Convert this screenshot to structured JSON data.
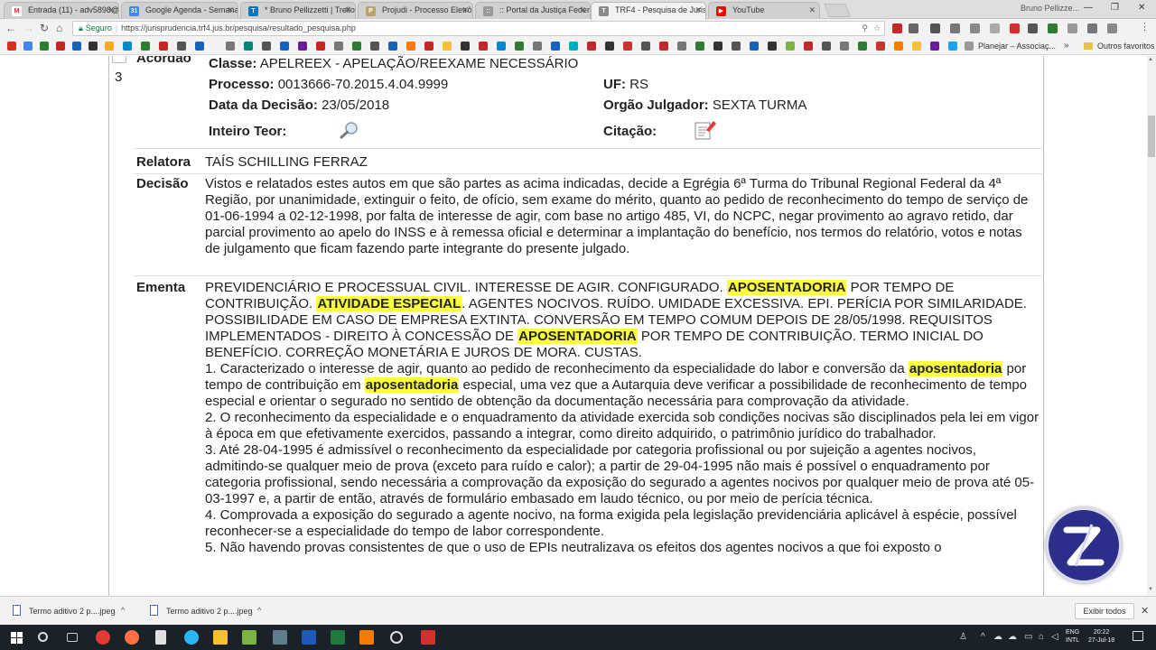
{
  "browser": {
    "tabs": [
      {
        "title": "Entrada (11) - adv5898@...",
        "color": "#d93025",
        "glyph": "M"
      },
      {
        "title": "Google Agenda - Semana...",
        "color": "#4285f4",
        "glyph": "31"
      },
      {
        "title": "* Bruno Pellizzetti | Trello",
        "color": "#0079bf",
        "glyph": "T"
      },
      {
        "title": "Projudi - Processo Eletrô...",
        "color": "#b9a36a",
        "glyph": "P"
      },
      {
        "title": ":: Portal da Justiça Federal...",
        "color": "#999999",
        "glyph": "::"
      },
      {
        "title": "TRF4 - Pesquisa de Jurisp...",
        "color": "#8a8a8a",
        "glyph": "T"
      },
      {
        "title": "YouTube",
        "color": "#ff0000",
        "glyph": "▶"
      }
    ],
    "active_tab": 5,
    "window_user": "Bruno Pellizze...",
    "secure_label": "Seguro",
    "url": "https://jurisprudencia.trf4.jus.br/pesquisa/resultado_pesquisa.php",
    "bookmarks": {
      "planejar": "Planejar – Associaç...",
      "more": "»",
      "other": "Outros favoritos"
    }
  },
  "result": {
    "number": "3",
    "tipo_label": "Acordão",
    "classe_label": "Classe:",
    "classe_value": "APELREEX - APELAÇÃO/REEXAME NECESSÁRIO",
    "processo_label": "Processo:",
    "processo_value": "0013666-70.2015.4.04.9999",
    "uf_label": "UF:",
    "uf_value": "RS",
    "data_label": "Data da Decisão:",
    "data_value": "23/05/2018",
    "orgao_label": "Orgão Julgador:",
    "orgao_value": "SEXTA TURMA",
    "inteiro_label": "Inteiro Teor:",
    "citacao_label": "Citação:",
    "relatora_label": "Relatora",
    "relatora_value": "TAÍS SCHILLING FERRAZ",
    "decisao_label": "Decisão",
    "decisao_text": "Vistos e relatados estes autos em que são partes as acima indicadas, decide a Egrégia 6ª Turma do Tribunal Regional Federal da 4ª Região, por unanimidade, extinguir o feito, de ofício, sem exame do mérito, quanto ao pedido de reconhecimento do tempo de serviço de 01-06-1994 a 02-12-1998, por falta de interesse de agir, com base no artigo 485, VI, do NCPC, negar provimento ao agravo retido, dar parcial provimento ao apelo do INSS e à remessa oficial e determinar a implantação do benefício, nos termos do relatório, votos e notas de julgamento que ficam fazendo parte integrante do presente julgado.",
    "ementa_label": "Ementa",
    "ementa_heading": [
      "PREVIDENCIÁRIO E PROCESSUAL CIVIL. INTERESSE DE AGIR. CONFIGURADO. ",
      "APOSENTADORIA",
      " POR TEMPO DE CONTRIBUIÇÃO. ",
      "ATIVIDADE ESPECIAL",
      ". AGENTES NOCIVOS. RUÍDO. UMIDADE EXCESSIVA. EPI. PERÍCIA POR SIMILARIDADE. POSSIBILIDADE EM CASO DE EMPRESA EXTINTA. CONVERSÃO EM TEMPO COMUM DEPOIS DE 28/05/1998. REQUISITOS IMPLEMENTADOS - DIREITO À CONCESSÃO DE ",
      "APOSENTADORIA",
      " POR TEMPO DE CONTRIBUIÇÃO. TERMO INICIAL DO BENEFÍCIO. CORREÇÃO MONETÁRIA E JUROS DE MORA. CUSTAS."
    ],
    "item1": [
      "1. Caracterizado o interesse de agir, quanto ao pedido de reconhecimento da especialidade do labor e conversão da ",
      "aposentadoria",
      " por tempo de contribuição em ",
      "aposentadoria",
      " especial, uma vez que a Autarquia deve verificar a possibilidade de reconhecimento de tempo especial e orientar o segurado no sentido de obtenção da documentação necessária para comprovação da atividade."
    ],
    "item2": "2. O reconhecimento da especialidade e o enquadramento da atividade exercida sob condições nocivas são disciplinados pela lei em vigor à época em que efetivamente exercidos, passando a integrar, como direito adquirido, o patrimônio jurídico do trabalhador.",
    "item3": "3. Até 28-04-1995 é admissível o reconhecimento da especialidade por categoria profissional ou por sujeição a agentes nocivos, admitindo-se qualquer meio de prova (exceto para ruído e calor); a partir de 29-04-1995 não mais é possível o enquadramento por categoria profissional, sendo necessária a comprovação da exposição do segurado a agentes nocivos por qualquer meio de prova até 05-03-1997 e, a partir de então, através de formulário embasado em laudo técnico, ou por meio de perícia técnica.",
    "item4": "4. Comprovada a exposição do segurado a agente nocivo, na forma exigida pela legislação previdenciária aplicável à espécie, possível reconhecer-se a especialidade do tempo de labor correspondente.",
    "item5": "5. Não havendo provas consistentes de que o uso de EPIs neutralizava os efeitos dos agentes nocivos a que foi exposto o"
  },
  "downloads": {
    "items": [
      "Termo aditivo 2 p....jpeg",
      "Termo aditivo 2 p....jpeg"
    ],
    "show_all": "Exibir todos"
  },
  "taskbar": {
    "lang_line1": "ENG",
    "lang_line2": "INTL",
    "time": "20:22",
    "date": "27-Jul-18"
  },
  "colors": {
    "highlight": "#fbff3f",
    "channel_logo": "#2b2f8a"
  }
}
